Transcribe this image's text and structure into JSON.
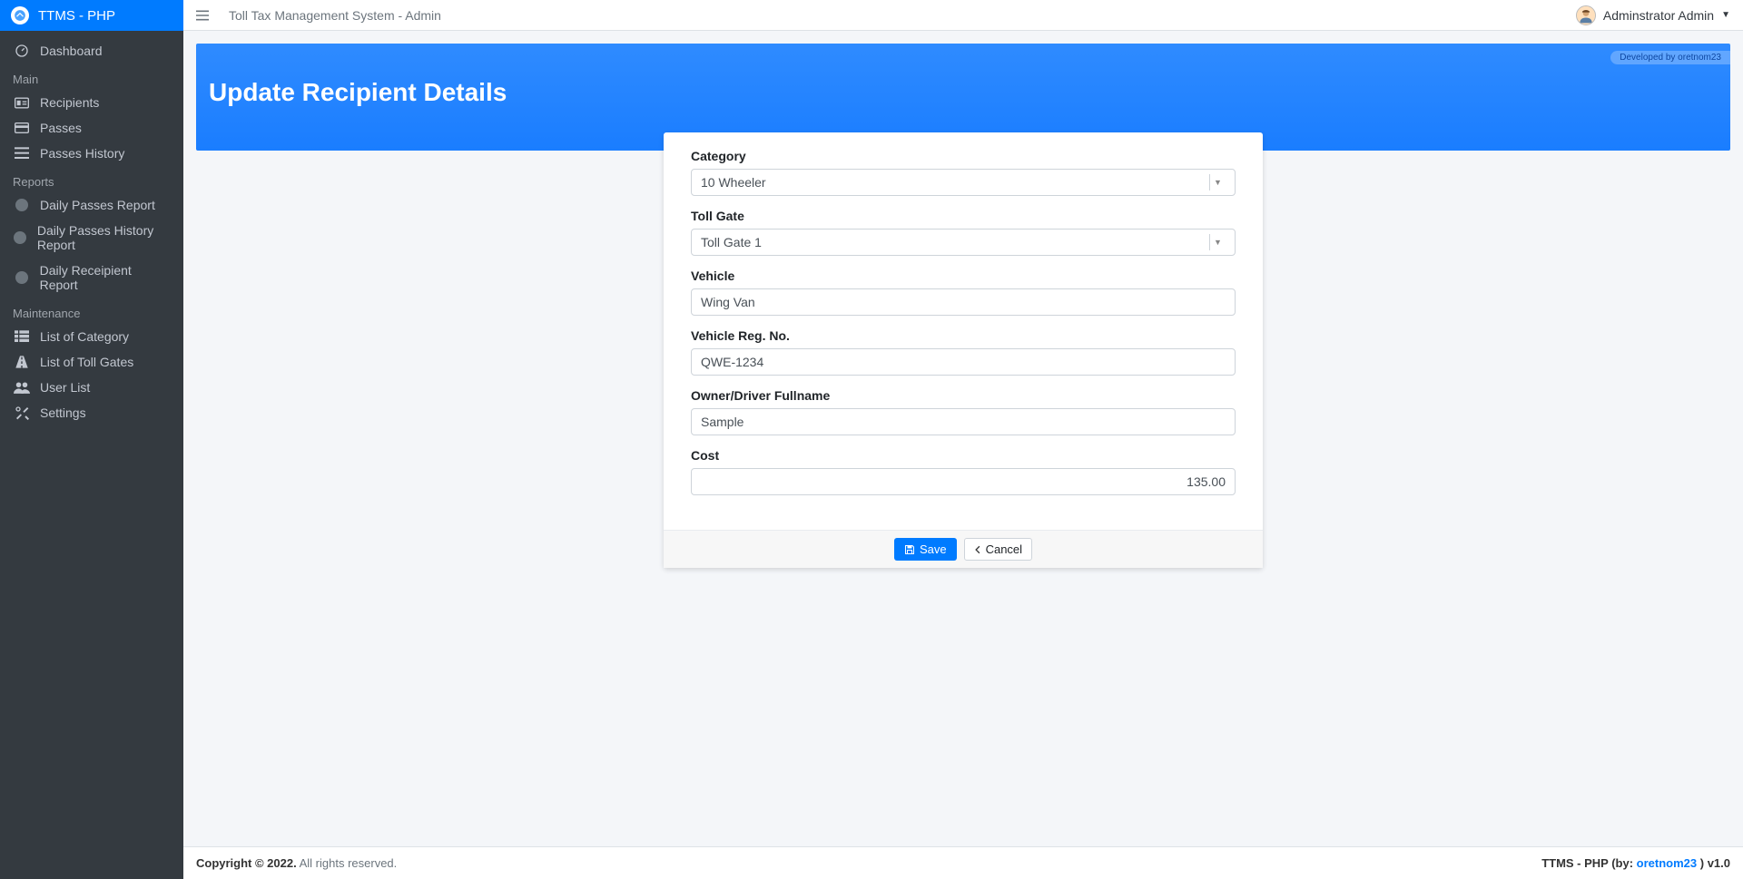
{
  "brand": {
    "title": "TTMS - PHP"
  },
  "sidebar": {
    "dashboard": "Dashboard",
    "headers": {
      "main": "Main",
      "reports": "Reports",
      "maintenance": "Maintenance"
    },
    "main": {
      "recipients": "Recipients",
      "passes": "Passes",
      "passes_history": "Passes History"
    },
    "reports": {
      "daily_passes": "Daily Passes Report",
      "daily_passes_history": "Daily Passes History Report",
      "daily_recipient": "Daily Receipient Report"
    },
    "maintenance": {
      "category_list": "List of Category",
      "toll_gates": "List of Toll Gates",
      "user_list": "User List",
      "settings": "Settings"
    }
  },
  "topbar": {
    "title": "Toll Tax Management System - Admin",
    "user": "Adminstrator Admin"
  },
  "page": {
    "title": "Update Recipient Details",
    "dev_badge": "Developed by oretnom23"
  },
  "form": {
    "category": {
      "label": "Category",
      "value": "10 Wheeler"
    },
    "toll_gate": {
      "label": "Toll Gate",
      "value": "Toll Gate 1"
    },
    "vehicle": {
      "label": "Vehicle",
      "value": "Wing Van"
    },
    "reg_no": {
      "label": "Vehicle Reg. No.",
      "value": "QWE-1234"
    },
    "owner": {
      "label": "Owner/Driver Fullname",
      "value": "Sample"
    },
    "cost": {
      "label": "Cost",
      "value": "135.00"
    },
    "buttons": {
      "save": "Save",
      "cancel": "Cancel"
    }
  },
  "footer": {
    "copyright_bold": "Copyright © 2022.",
    "copyright_rest": " All rights reserved.",
    "right_prefix": "TTMS - PHP (by: ",
    "right_link": "oretnom23",
    "right_suffix": " ) v1.0"
  }
}
